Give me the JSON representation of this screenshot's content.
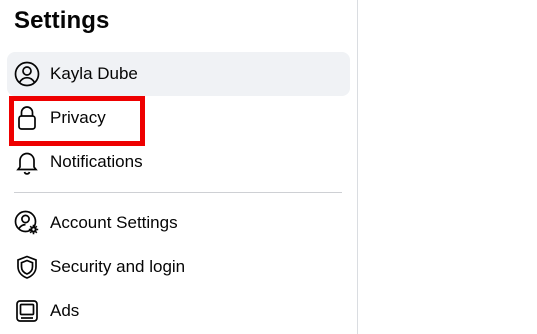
{
  "sidebar": {
    "title": "Settings",
    "items": [
      {
        "label": "Kayla Dube",
        "icon": "profile-icon",
        "active": true
      },
      {
        "label": "Privacy",
        "icon": "lock-icon",
        "active": false
      },
      {
        "label": "Notifications",
        "icon": "bell-icon",
        "active": false
      },
      {
        "label": "Account Settings",
        "icon": "account-settings-icon",
        "active": false
      },
      {
        "label": "Security and login",
        "icon": "shield-icon",
        "active": false
      },
      {
        "label": "Ads",
        "icon": "ads-icon",
        "active": false
      }
    ]
  },
  "highlight": {
    "color": "#ee0000",
    "target": "Privacy"
  }
}
